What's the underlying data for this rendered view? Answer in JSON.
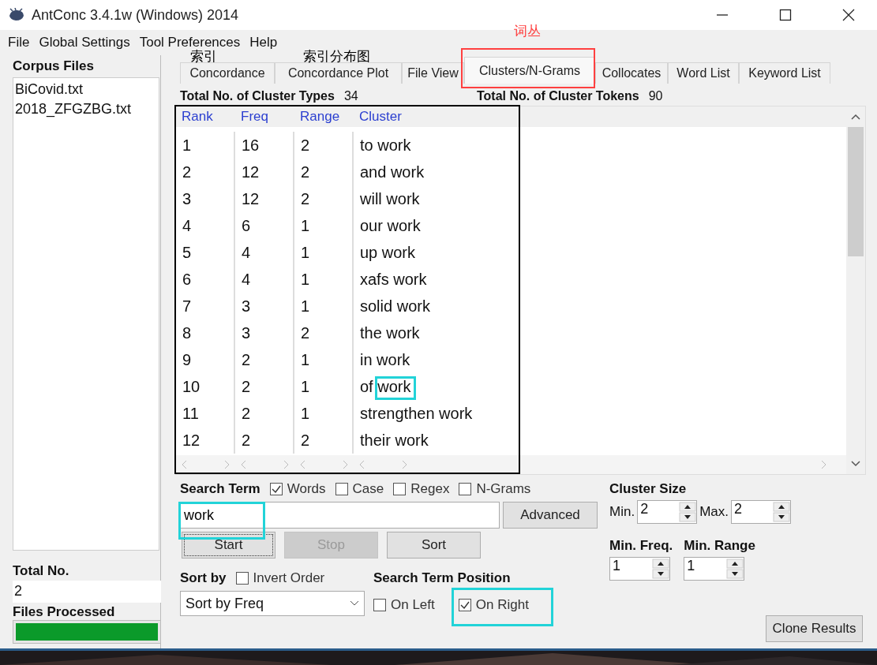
{
  "window": {
    "title": "AntConc 3.4.1w (Windows) 2014"
  },
  "menu": [
    "File",
    "Global Settings",
    "Tool Preferences",
    "Help"
  ],
  "corpus_files": {
    "label": "Corpus Files",
    "files": [
      "BiCovid.txt",
      "2018_ZFGZBG.txt"
    ]
  },
  "total_no": {
    "label": "Total No.",
    "value": "2"
  },
  "files_processed": {
    "label": "Files Processed",
    "level": 1
  },
  "tabs": [
    {
      "label": "Concordance",
      "selected": false
    },
    {
      "label": "Concordance Plot",
      "selected": false
    },
    {
      "label": "File View",
      "selected": false
    },
    {
      "label": "Clusters/N-Grams",
      "selected": true
    },
    {
      "label": "Collocates",
      "selected": false
    },
    {
      "label": "Word List",
      "selected": false
    },
    {
      "label": "Keyword List",
      "selected": false
    }
  ],
  "stats": [
    {
      "label": "Total No. of Cluster Types",
      "value": "34"
    },
    {
      "label": "Total No. of Cluster Tokens",
      "value": "90"
    }
  ],
  "table": {
    "columns": [
      "Rank",
      "Freq",
      "Range",
      "Cluster"
    ],
    "rows": [
      [
        "1",
        "16",
        "2",
        "to work"
      ],
      [
        "2",
        "12",
        "2",
        "and work"
      ],
      [
        "3",
        "12",
        "2",
        "will work"
      ],
      [
        "4",
        "6",
        "1",
        "our work"
      ],
      [
        "5",
        "4",
        "1",
        "up work"
      ],
      [
        "6",
        "4",
        "1",
        "xafs work"
      ],
      [
        "7",
        "3",
        "1",
        "solid work"
      ],
      [
        "8",
        "3",
        "2",
        "the work"
      ],
      [
        "9",
        "2",
        "1",
        "in work"
      ],
      [
        "10",
        "2",
        "1",
        "of work"
      ],
      [
        "11",
        "2",
        "1",
        "strengthen work"
      ],
      [
        "12",
        "2",
        "2",
        "their work"
      ]
    ]
  },
  "search": {
    "label": "Search Term",
    "options": [
      {
        "label": "Words",
        "checked": true
      },
      {
        "label": "Case",
        "checked": false
      },
      {
        "label": "Regex",
        "checked": false
      },
      {
        "label": "N-Grams",
        "checked": false
      }
    ],
    "value": "work",
    "advanced": "Advanced"
  },
  "buttons": [
    {
      "label": "Start",
      "disabled": false
    },
    {
      "label": "Stop",
      "disabled": true
    },
    {
      "label": "Sort",
      "disabled": false
    }
  ],
  "sort": {
    "label": "Sort by",
    "invert": {
      "label": "Invert Order",
      "checked": false
    },
    "value": "Sort by Freq"
  },
  "position": {
    "label": "Search Term Position",
    "options": [
      {
        "label": "On Left",
        "checked": false
      },
      {
        "label": "On Right",
        "checked": true
      }
    ]
  },
  "cluster_size": {
    "label": "Cluster Size",
    "min_label": "Min.",
    "min": "2",
    "max_label": "Max.",
    "max": "2"
  },
  "thresholds": [
    {
      "label": "Min. Freq.",
      "value": "1"
    },
    {
      "label": "Min. Range",
      "value": "1"
    }
  ],
  "clone_button": "Clone Results",
  "annotations": [
    {
      "text": "索引",
      "color": "#000000"
    },
    {
      "text": "索引分布图",
      "color": "#000000"
    },
    {
      "text": "词丛",
      "color": "#ff3b3b"
    }
  ],
  "highlight_boxes": [
    {
      "color": "#000000"
    },
    {
      "color": "#ff4040"
    },
    {
      "color": "#22d3d8"
    },
    {
      "color": "#22d3d8"
    },
    {
      "color": "#22d3d8"
    }
  ]
}
